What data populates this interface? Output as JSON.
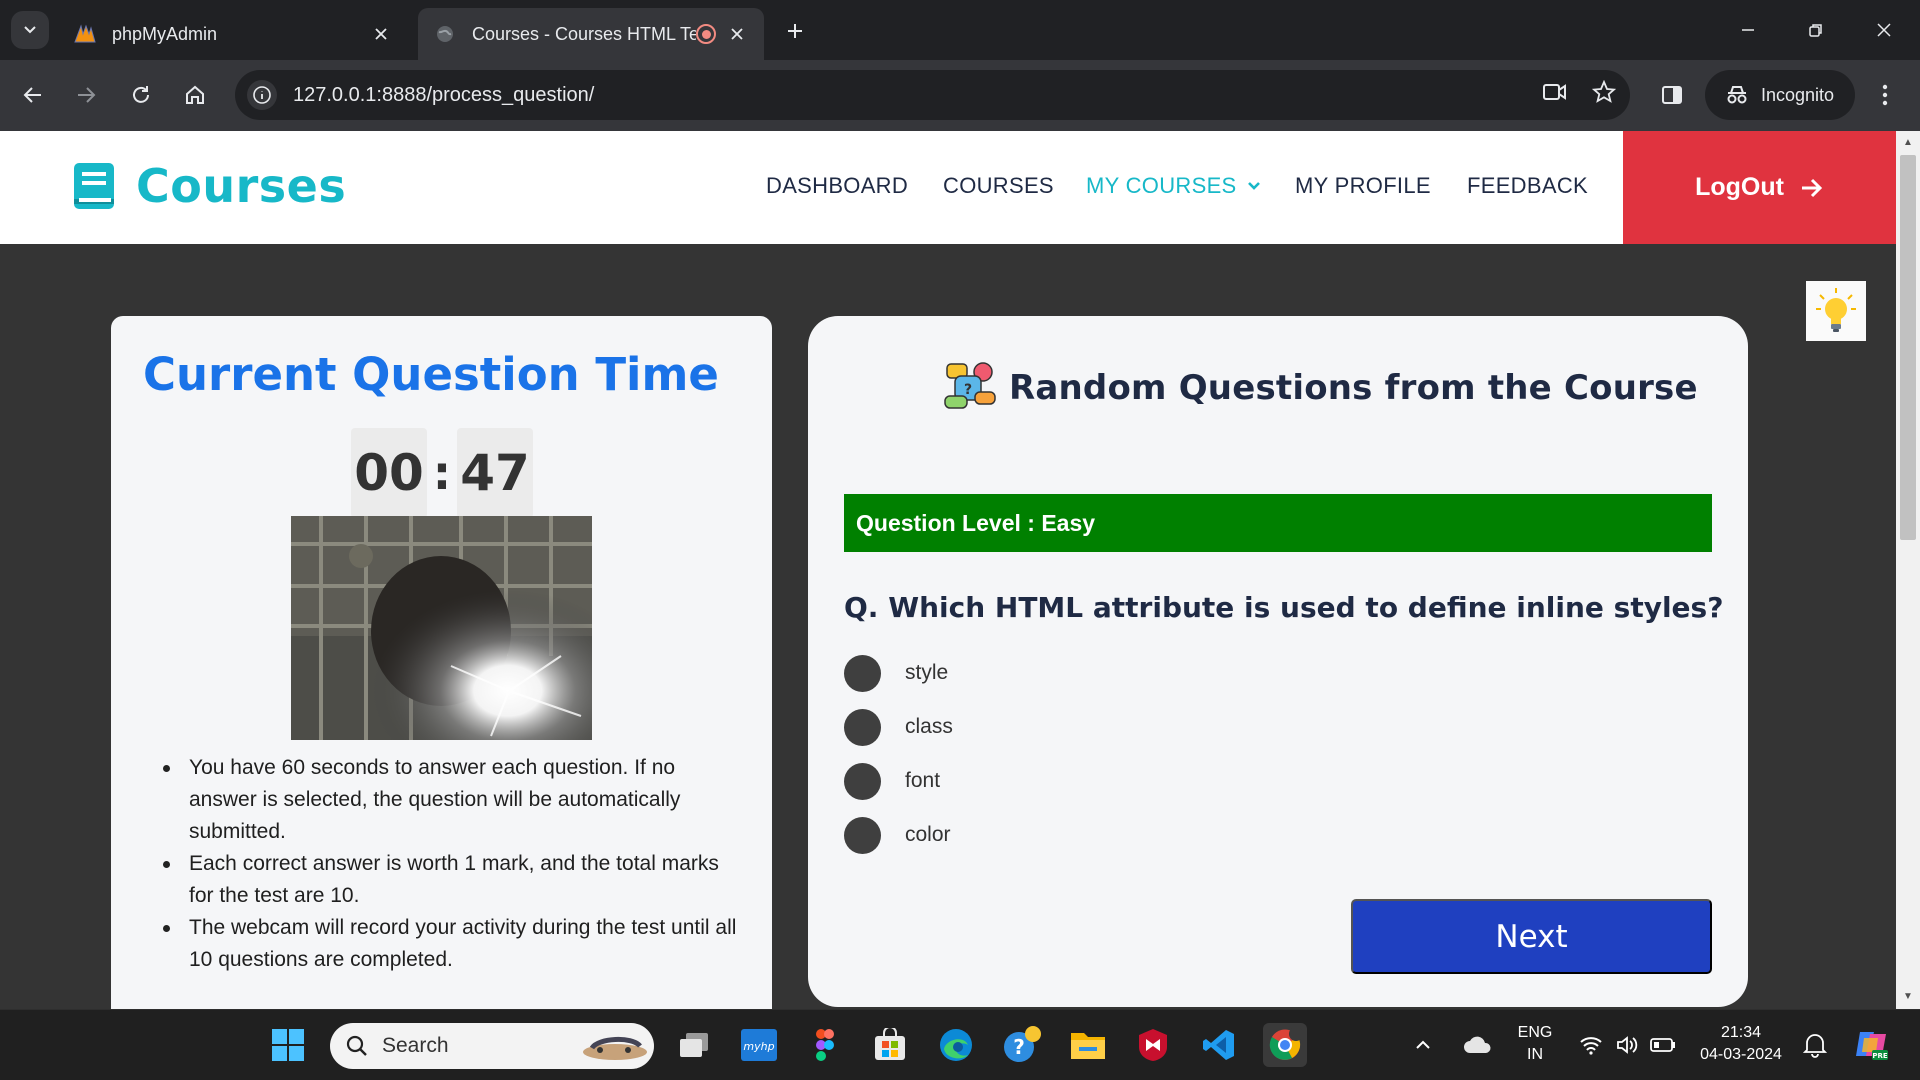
{
  "browser": {
    "tabs": [
      {
        "title": "phpMyAdmin",
        "icon": "phpmyadmin-icon",
        "active": false
      },
      {
        "title": "Courses - Courses HTML Te",
        "icon": "globe-icon",
        "active": true
      }
    ],
    "url": "127.0.0.1:8888/process_question/",
    "incognito_label": "Incognito"
  },
  "site": {
    "brand": "Courses",
    "nav": {
      "dashboard": "DASHBOARD",
      "courses": "COURSES",
      "my_courses": "MY COURSES",
      "my_profile": "MY PROFILE",
      "feedback": "FEEDBACK"
    },
    "logout": "LogOut",
    "colors": {
      "brand": "#17b8c8",
      "logout": "#e0333f",
      "level_bar": "#008000",
      "next": "#1f40c0",
      "timer_title": "#1a73e8"
    }
  },
  "timer": {
    "title": "Current Question Time",
    "minutes": "00",
    "separator": ":",
    "seconds": "47"
  },
  "rules": [
    "You have 60 seconds to answer each question. If no answer is selected, the question will be automatically submitted.",
    "Each correct answer is worth 1 mark, and the total marks for the test are 10.",
    "The webcam will record your activity during the test until all 10 questions are completed."
  ],
  "quiz": {
    "heading": "Random Questions from the Course",
    "level": "Question Level : Easy",
    "question": "Q. Which HTML attribute is used to define inline styles?",
    "options": [
      "style",
      "class",
      "font",
      "color"
    ],
    "next": "Next"
  },
  "taskbar": {
    "search_placeholder": "Search",
    "language": "ENG",
    "region": "IN",
    "time": "21:34",
    "date": "04-03-2024"
  }
}
